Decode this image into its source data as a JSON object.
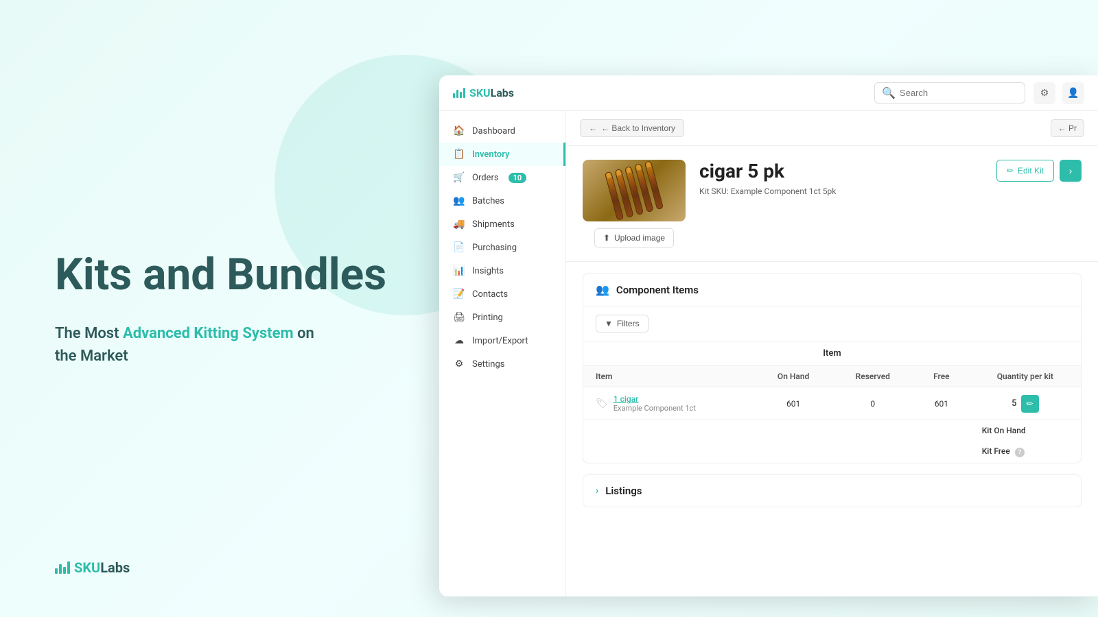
{
  "marketing": {
    "title_line1": "Kits and Bundles",
    "subtitle_part1": "The Most ",
    "subtitle_accent": "Advanced Kitting System",
    "subtitle_part2": " on",
    "subtitle_line2": "the Market",
    "logo_sku": "SKU",
    "logo_labs": "Labs"
  },
  "topbar": {
    "logo_sku": "SKU",
    "logo_labs": "Labs",
    "search_placeholder": "Search"
  },
  "sidebar": {
    "items": [
      {
        "label": "Dashboard",
        "icon": "🏠",
        "active": false
      },
      {
        "label": "Inventory",
        "icon": "📋",
        "active": true
      },
      {
        "label": "Orders",
        "icon": "🛒",
        "active": false,
        "badge": "10"
      },
      {
        "label": "Batches",
        "icon": "👥",
        "active": false
      },
      {
        "label": "Shipments",
        "icon": "🚚",
        "active": false
      },
      {
        "label": "Purchasing",
        "icon": "📄",
        "active": false
      },
      {
        "label": "Insights",
        "icon": "📊",
        "active": false
      },
      {
        "label": "Contacts",
        "icon": "📝",
        "active": false
      },
      {
        "label": "Printing",
        "icon": "🖨️",
        "active": false
      },
      {
        "label": "Import/Export",
        "icon": "☁️",
        "active": false
      },
      {
        "label": "Settings",
        "icon": "⚙️",
        "active": false
      }
    ]
  },
  "back_button": "← Back to Inventory",
  "partial_nav": "← Pr",
  "kit": {
    "name": "cigar 5 pk",
    "sku_label": "Kit SKU:",
    "sku_value": "Example Component 1ct 5pk",
    "edit_button": "Edit Kit",
    "upload_button": "Upload image"
  },
  "component_items": {
    "section_title": "Component Items",
    "filters_button": "Filters",
    "table_header": "Item",
    "columns": [
      "Item",
      "On Hand",
      "Reserved",
      "Free",
      "Quantity per kit"
    ],
    "rows": [
      {
        "name": "1 cigar",
        "sub": "Example Component 1ct",
        "on_hand": "601",
        "reserved": "0",
        "free": "601",
        "qty_per_kit": "5"
      }
    ],
    "summary": [
      {
        "label": "Kit On Hand"
      },
      {
        "label": "Kit Free",
        "has_help": true
      }
    ]
  },
  "listings": {
    "section_title": "Listings"
  }
}
